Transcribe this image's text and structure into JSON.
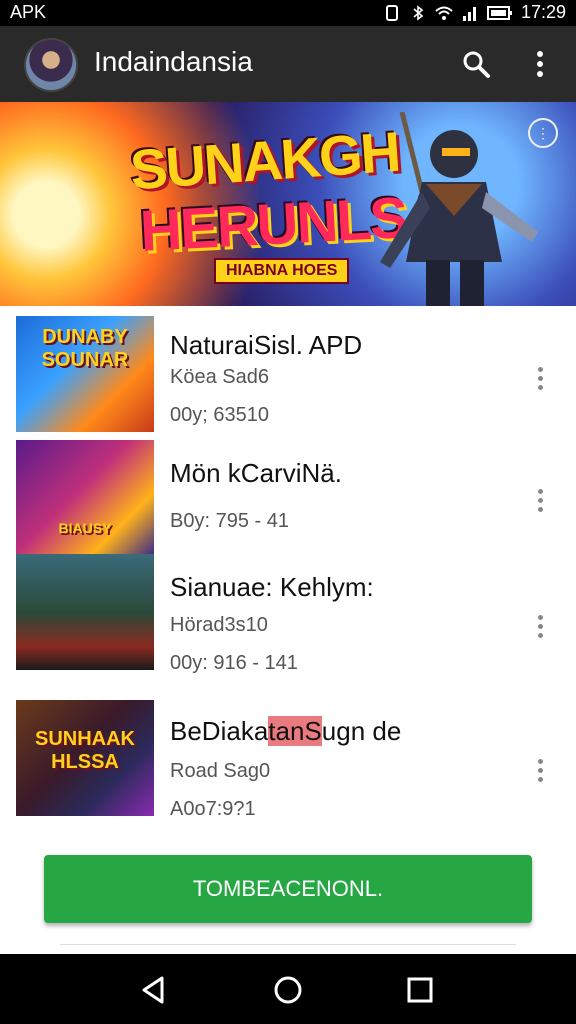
{
  "status_bar": {
    "left_text": "APK",
    "time": "17:29"
  },
  "app_bar": {
    "title": "Indaindansia"
  },
  "banner": {
    "line1": "SUNAKGH",
    "line2": "HERUNLSA",
    "tagline": "HIABNA HOES"
  },
  "items": [
    {
      "name": "NaturaiSisl. APD",
      "meta1": "Köea Sad6",
      "meta2": "00y; 63510",
      "thumb_label": "DUNABY SOUNAR"
    },
    {
      "name": "Mön kCarviNä.",
      "meta1": "",
      "meta2": "B0y: 795 - 41",
      "thumb_label": "BIAUSY"
    },
    {
      "name": "Sianuae: Kehlym:",
      "meta1": "Hörad3s10",
      "meta2": "00y: 916 - 141",
      "thumb_label": ""
    },
    {
      "name_prefix": "BeDiaka",
      "name_highlight": "tanS",
      "name_suffix": "ugn de",
      "meta1": "Road Sag0",
      "meta2": "A0o7:9?1",
      "thumb_label": "SUNHAAK HLSSA"
    }
  ],
  "cta": {
    "label": "TOMBEACENONL."
  }
}
